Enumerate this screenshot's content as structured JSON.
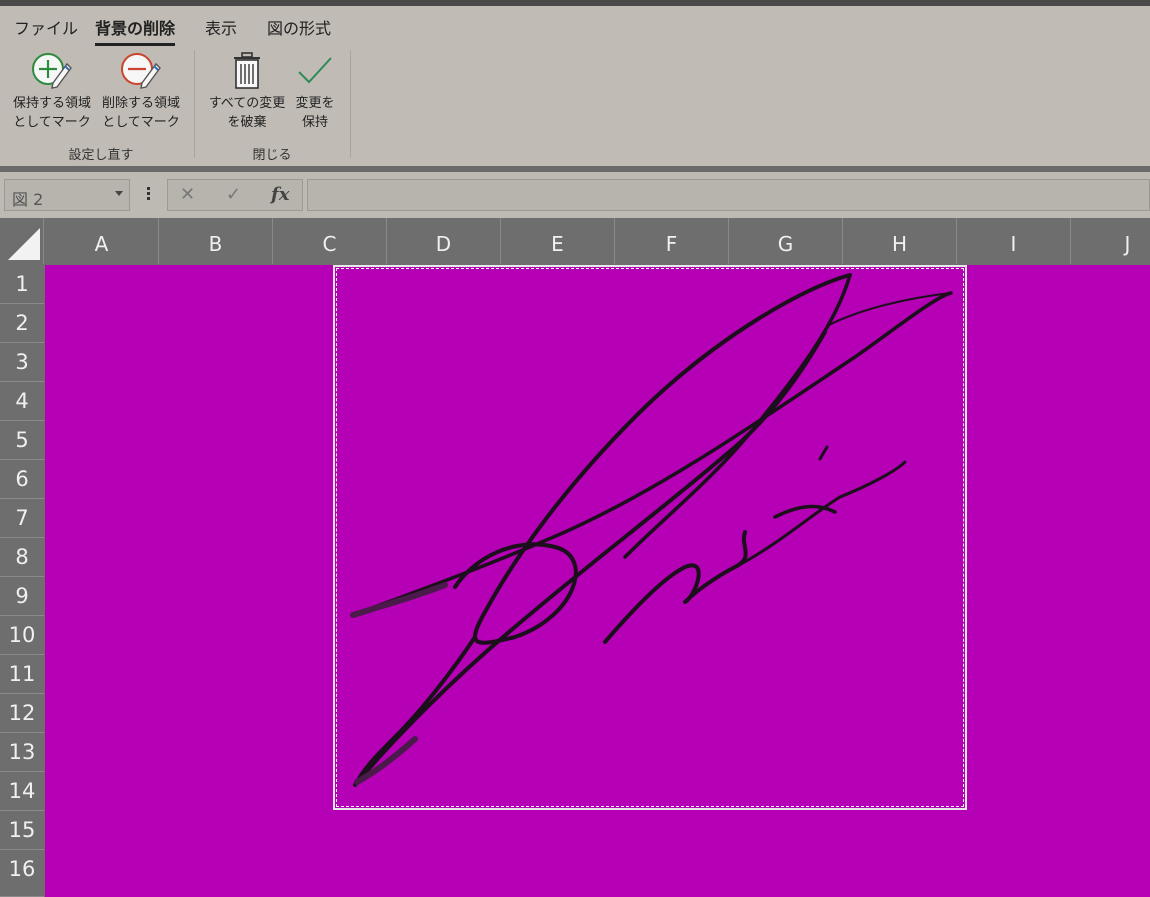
{
  "tabs": [
    {
      "label": "ファイル",
      "active": false
    },
    {
      "label": "背景の削除",
      "active": true
    },
    {
      "label": "表示",
      "active": false
    },
    {
      "label": "図の形式",
      "active": false
    }
  ],
  "ribbon": {
    "keep_label": "保持する領域\nとしてマーク",
    "remove_label": "削除する領域\nとしてマーク",
    "discard_label": "すべての変更\nを破棄",
    "keep_changes_label": "変更を\n保持",
    "group_refine": "設定し直す",
    "group_close": "閉じる"
  },
  "formula_bar": {
    "name_box": "図 2",
    "cancel": "✕",
    "enter": "✓",
    "fx": "fx",
    "value": ""
  },
  "columns": [
    "A",
    "B",
    "C",
    "D",
    "E",
    "F",
    "G",
    "H",
    "I",
    "J"
  ],
  "rows": [
    "1",
    "2",
    "3",
    "4",
    "5",
    "6",
    "7",
    "8",
    "9",
    "10",
    "11",
    "12",
    "13",
    "14",
    "15",
    "16"
  ],
  "colors": {
    "removed_area": "#b500b5",
    "ribbon_bg": "#c0bcb5",
    "grid_header": "#6e6e6e"
  }
}
